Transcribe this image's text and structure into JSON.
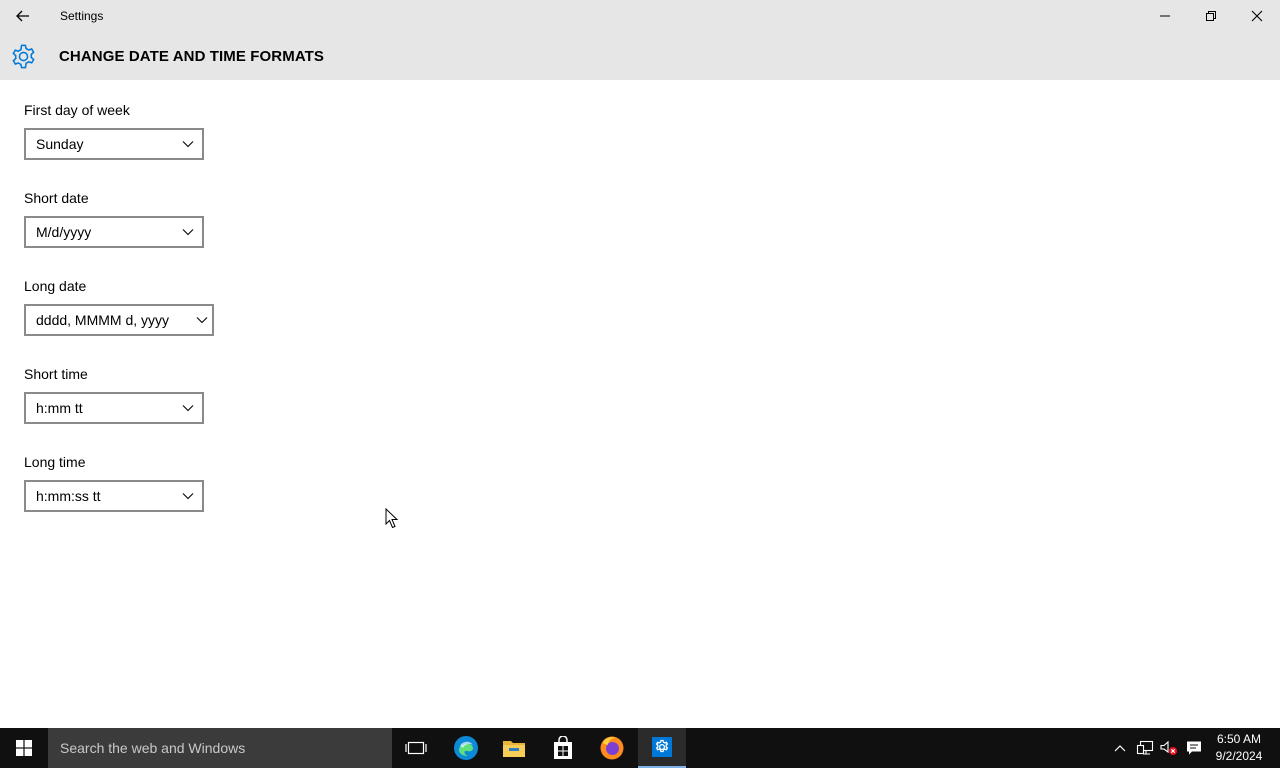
{
  "window": {
    "app_title": "Settings"
  },
  "header": {
    "title": "CHANGE DATE AND TIME FORMATS"
  },
  "fields": [
    {
      "label": "First day of week",
      "value": "Sunday"
    },
    {
      "label": "Short date",
      "value": "M/d/yyyy"
    },
    {
      "label": "Long date",
      "value": "dddd, MMMM d, yyyy"
    },
    {
      "label": "Short time",
      "value": "h:mm tt"
    },
    {
      "label": "Long time",
      "value": "h:mm:ss tt"
    }
  ],
  "taskbar": {
    "search_placeholder": "Search the web and Windows",
    "pinned": [
      "task-view-icon",
      "edge-icon",
      "file-explorer-icon",
      "store-icon",
      "firefox-icon",
      "settings-icon"
    ],
    "clock": {
      "time": "6:50 AM",
      "date": "9/2/2024"
    }
  },
  "colors": {
    "titlebar_bg": "#e6e6e6",
    "accent": "#0078d7",
    "taskbar_bg": "#101010"
  }
}
